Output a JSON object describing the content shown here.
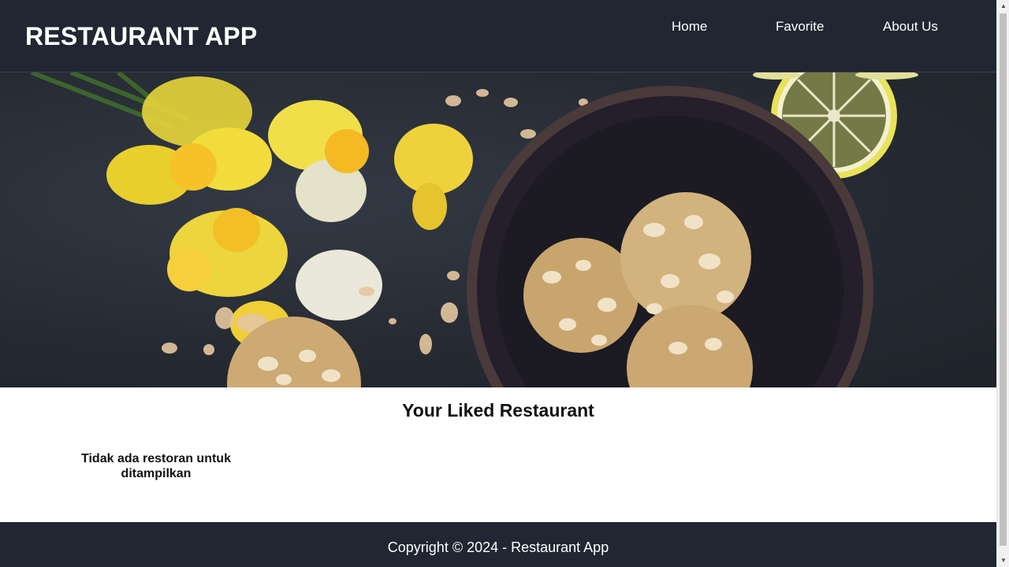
{
  "header": {
    "brand": "RESTAURANT APP",
    "nav": [
      {
        "label": "Home"
      },
      {
        "label": "Favorite"
      },
      {
        "label": "About Us"
      }
    ]
  },
  "hero": {
    "image_semantic": "food-photo-cookies-daffodils-lemon"
  },
  "main": {
    "title": "Your Liked Restaurant",
    "empty_message": "Tidak ada restoran untuk ditampilkan"
  },
  "footer": {
    "text": "Copyright © 2024 - Restaurant App"
  },
  "colors": {
    "header_bg": "#212632",
    "footer_bg": "#212632",
    "text_light": "#ffffff",
    "text_dark": "#111111"
  }
}
